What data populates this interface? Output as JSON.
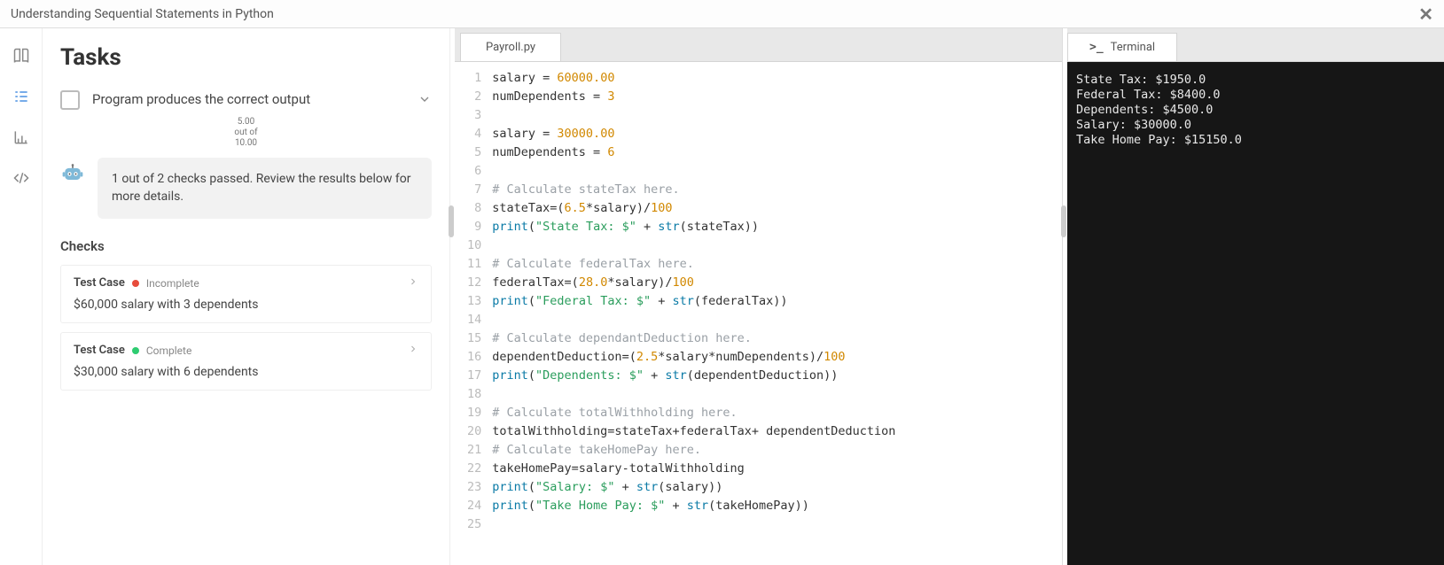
{
  "titlebar": {
    "title": "Understanding Sequential Statements in Python"
  },
  "rail": {
    "items": [
      "book-icon",
      "tasks-icon",
      "chart-icon",
      "code-icon"
    ]
  },
  "tasks": {
    "heading": "Tasks",
    "current_task": "Program produces the correct output",
    "score_top": "5.00",
    "score_mid": "out of",
    "score_bot": "10.00",
    "message": "1 out of 2 checks passed. Review the results below for more details.",
    "checks_label": "Checks",
    "tc_label": "Test Case",
    "status_incomplete": "Incomplete",
    "status_complete": "Complete",
    "checks": [
      {
        "status": "incomplete",
        "desc": "$60,000 salary with 3 dependents"
      },
      {
        "status": "complete",
        "desc": "$30,000 salary with 6 dependents"
      }
    ]
  },
  "editor": {
    "tab_label": "Payroll.py",
    "lines": [
      [
        [
          "",
          "salary = "
        ],
        [
          "num",
          "60000.00"
        ]
      ],
      [
        [
          "",
          "numDependents = "
        ],
        [
          "num",
          "3"
        ]
      ],
      [],
      [
        [
          "",
          "salary = "
        ],
        [
          "num",
          "30000.00"
        ]
      ],
      [
        [
          "",
          "numDependents = "
        ],
        [
          "num",
          "6"
        ]
      ],
      [],
      [
        [
          "com",
          "# Calculate stateTax here."
        ]
      ],
      [
        [
          "",
          "stateTax=("
        ],
        [
          "num",
          "6.5"
        ],
        [
          "",
          "*salary)/"
        ],
        [
          "num",
          "100"
        ]
      ],
      [
        [
          "fn",
          "print"
        ],
        [
          "",
          "("
        ],
        [
          "str",
          "\"State Tax: $\""
        ],
        [
          "",
          " + "
        ],
        [
          "fn",
          "str"
        ],
        [
          "",
          "(stateTax))"
        ]
      ],
      [],
      [
        [
          "com",
          "# Calculate federalTax here."
        ]
      ],
      [
        [
          "",
          "federalTax=("
        ],
        [
          "num",
          "28.0"
        ],
        [
          "",
          "*salary)/"
        ],
        [
          "num",
          "100"
        ]
      ],
      [
        [
          "fn",
          "print"
        ],
        [
          "",
          "("
        ],
        [
          "str",
          "\"Federal Tax: $\""
        ],
        [
          "",
          " + "
        ],
        [
          "fn",
          "str"
        ],
        [
          "",
          "(federalTax))"
        ]
      ],
      [],
      [
        [
          "com",
          "# Calculate dependantDeduction here."
        ]
      ],
      [
        [
          "",
          "dependentDeduction=("
        ],
        [
          "num",
          "2.5"
        ],
        [
          "",
          "*salary*numDependents)/"
        ],
        [
          "num",
          "100"
        ]
      ],
      [
        [
          "fn",
          "print"
        ],
        [
          "",
          "("
        ],
        [
          "str",
          "\"Dependents: $\""
        ],
        [
          "",
          " + "
        ],
        [
          "fn",
          "str"
        ],
        [
          "",
          "(dependentDeduction))"
        ]
      ],
      [],
      [
        [
          "com",
          "# Calculate totalWithholding here."
        ]
      ],
      [
        [
          "",
          "totalWithholding=stateTax+federalTax+ dependentDeduction"
        ]
      ],
      [
        [
          "com",
          "# Calculate takeHomePay here."
        ]
      ],
      [
        [
          "",
          "takeHomePay=salary-totalWithholding"
        ]
      ],
      [
        [
          "fn",
          "print"
        ],
        [
          "",
          "("
        ],
        [
          "str",
          "\"Salary: $\""
        ],
        [
          "",
          " + "
        ],
        [
          "fn",
          "str"
        ],
        [
          "",
          "(salary))"
        ]
      ],
      [
        [
          "fn",
          "print"
        ],
        [
          "",
          "("
        ],
        [
          "str",
          "\"Take Home Pay: $\""
        ],
        [
          "",
          " + "
        ],
        [
          "fn",
          "str"
        ],
        [
          "",
          "(takeHomePay))"
        ]
      ],
      []
    ]
  },
  "terminal": {
    "tab_label": "Terminal",
    "prompt": ">_",
    "lines": [
      "State Tax: $1950.0",
      "Federal Tax: $8400.0",
      "Dependents: $4500.0",
      "Salary: $30000.0",
      "Take Home Pay: $15150.0"
    ]
  }
}
